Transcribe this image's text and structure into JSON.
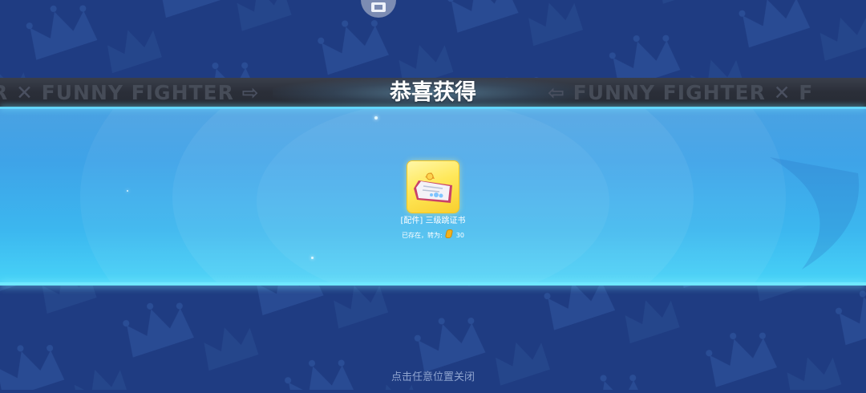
{
  "header": {
    "title": "恭喜获得",
    "marquee_left_prefix": "R",
    "marquee_text": "FUNNY FIGHTER",
    "marquee_right_suffix": "F"
  },
  "reward": {
    "item_name": "[配件] 三级跳证书",
    "converted_note": "已存在，转为:",
    "converted_amount": "30",
    "item_icon": "certificate-icon",
    "currency_icon": "coin-icon"
  },
  "footer": {
    "close_hint": "点击任意位置关闭"
  },
  "colors": {
    "background": "#1f3c82",
    "panel": "#3ea3e8",
    "accent_line": "#63d6ff",
    "item_frame": "#ffe85a"
  }
}
